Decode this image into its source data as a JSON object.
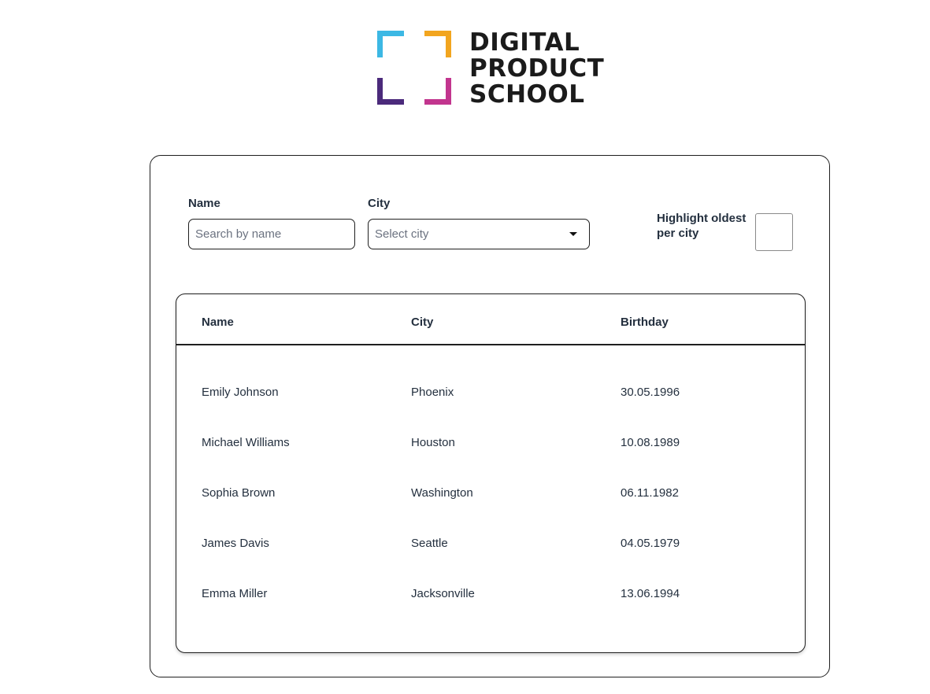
{
  "brand": {
    "line1": "DIGITAL",
    "line2": "PRODUCT",
    "line3": "SCHOOL",
    "colors": {
      "top_left": "#3cb8e4",
      "top_right": "#f2a51f",
      "bottom_left": "#4b2a7b",
      "bottom_right": "#c2358e"
    }
  },
  "filters": {
    "name_label": "Name",
    "name_placeholder": "Search by name",
    "city_label": "City",
    "city_placeholder": "Select city",
    "highlight_label": "Highlight oldest per city",
    "highlight_checked": false
  },
  "table": {
    "headers": [
      "Name",
      "City",
      "Birthday"
    ],
    "rows": [
      {
        "name": "Emily Johnson",
        "city": "Phoenix",
        "birthday": "30.05.1996"
      },
      {
        "name": "Michael Williams",
        "city": "Houston",
        "birthday": "10.08.1989"
      },
      {
        "name": "Sophia Brown",
        "city": "Washington",
        "birthday": "06.11.1982"
      },
      {
        "name": "James Davis",
        "city": "Seattle",
        "birthday": "04.05.1979"
      },
      {
        "name": "Emma Miller",
        "city": "Jacksonville",
        "birthday": "13.06.1994"
      }
    ]
  }
}
